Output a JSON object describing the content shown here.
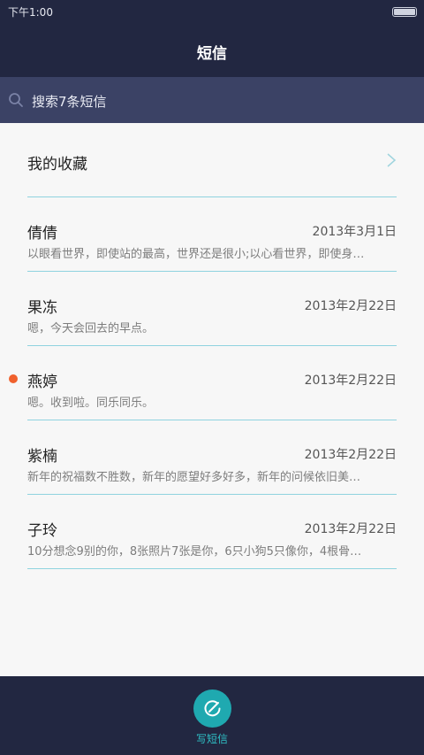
{
  "status_bar": {
    "time": "下午1:00"
  },
  "header": {
    "title": "短信"
  },
  "search": {
    "placeholder": "搜索7条短信"
  },
  "favorites": {
    "label": "我的收藏"
  },
  "conversations": [
    {
      "name": "倩倩",
      "date": "2013年3月1日",
      "preview": "以眼看世界，即使站的最高，世界还是很小;以心看世界，即使身…",
      "unread": false
    },
    {
      "name": "果冻",
      "date": "2013年2月22日",
      "preview": "嗯，今天会回去的早点。",
      "unread": false
    },
    {
      "name": "燕婷",
      "date": "2013年2月22日",
      "preview": "嗯。收到啦。同乐同乐。",
      "unread": true
    },
    {
      "name": "紫楠",
      "date": "2013年2月22日",
      "preview": "新年的祝福数不胜数，新年的愿望好多好多，新年的问候依旧美…",
      "unread": false
    },
    {
      "name": "子玲",
      "date": "2013年2月22日",
      "preview": "10分想念9别的你，8张照片7张是你，6只小狗5只像你，4根骨…",
      "unread": false
    }
  ],
  "bottom_bar": {
    "compose_label": "写短信"
  },
  "colors": {
    "header_bg": "#222741",
    "search_bg": "#3b4265",
    "accent": "#1fa9b0",
    "unread": "#f0612d",
    "divider": "#8fd3df"
  }
}
